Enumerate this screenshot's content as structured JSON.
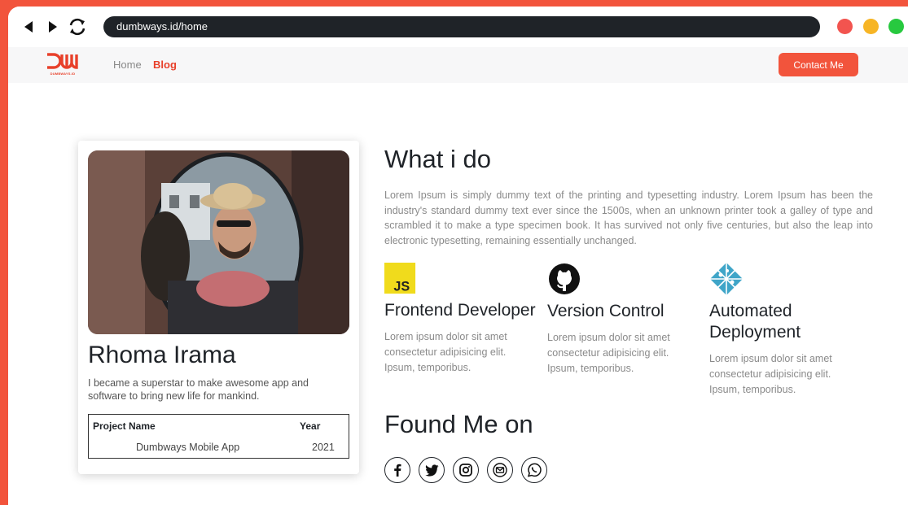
{
  "browser": {
    "url": "dumbways.id/home",
    "window_dots": [
      "#f2544f",
      "#f7b525",
      "#27c93f"
    ]
  },
  "navbar": {
    "logo_text": "DW",
    "logo_subtext": "DUMBWAYS.ID",
    "links": [
      {
        "label": "Home",
        "active": false
      },
      {
        "label": "Blog",
        "active": true
      }
    ],
    "contact_label": "Contact Me",
    "accent_color": "#f2543c"
  },
  "profile": {
    "name": "Rhoma Irama",
    "bio": "I became a superstar to make awesome app and software to bring new life for mankind.",
    "table": {
      "headers": [
        "Project Name",
        "Year"
      ],
      "rows": [
        [
          "Dumbways Mobile App",
          "2021"
        ]
      ]
    }
  },
  "about": {
    "title": "What i do",
    "description": "Lorem Ipsum is simply dummy text of the printing and typesetting industry. Lorem Ipsum has been the industry's standard dummy text ever since the 1500s, when an unknown printer took a galley of type and scrambled it to make a type specimen book. It has survived not only five centuries, but also the leap into electronic typesetting, remaining essentially unchanged."
  },
  "skills": [
    {
      "icon": "js-icon",
      "title": "Frontend Developer",
      "text": "Lorem ipsum dolor sit amet consectetur adipisicing elit. Ipsum, temporibus."
    },
    {
      "icon": "github-icon",
      "title": "Version Control",
      "text": "Lorem ipsum dolor sit amet consectetur adipisicing elit. Ipsum, temporibus."
    },
    {
      "icon": "netlify-icon",
      "title": "Automated Deployment",
      "text": "Lorem ipsum dolor sit amet consectetur adipisicing elit. Ipsum, temporibus."
    }
  ],
  "social": {
    "title": "Found Me on",
    "icons": [
      "facebook-icon",
      "twitter-icon",
      "instagram-icon",
      "email-icon",
      "whatsapp-icon"
    ]
  }
}
